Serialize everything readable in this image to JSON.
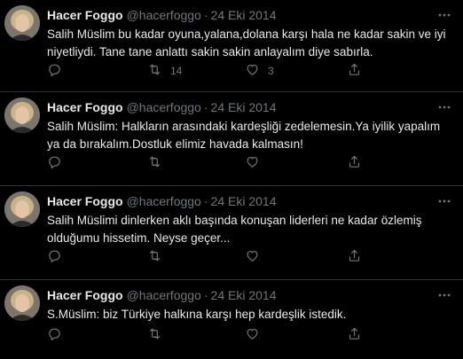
{
  "colors": {
    "background": "#000000",
    "text": "#e7e9ea",
    "muted": "#71767b",
    "divider": "#2f3336"
  },
  "icons": {
    "reply": "reply-icon",
    "retweet": "retweet-icon",
    "like": "heart-icon",
    "share": "share-icon",
    "more": "more-icon"
  },
  "tweets": [
    {
      "author_name": "Hacer Foggo",
      "handle": "@hacerfoggo",
      "separator": "·",
      "date": "24 Eki 2014",
      "text": "Salih Müslim bu kadar oyuna,yalana,dolana karşı hala ne kadar sakin ve iyi niyetliydi. Tane tane anlattı sakin sakin anlayalım diye sabırla.",
      "reply_count": "",
      "retweet_count": "14",
      "like_count": "3"
    },
    {
      "author_name": "Hacer Foggo",
      "handle": "@hacerfoggo",
      "separator": "·",
      "date": "24 Eki 2014",
      "text": "Salih Müslim: Halkların arasındaki kardeşliği zedelemesin.Ya iyilik yapalım ya da bırakalım.Dostluk elimiz havada kalmasın!",
      "reply_count": "",
      "retweet_count": "",
      "like_count": ""
    },
    {
      "author_name": "Hacer Foggo",
      "handle": "@hacerfoggo",
      "separator": "·",
      "date": "24 Eki 2014",
      "text": "Salih Müslimi dinlerken aklı başında konuşan liderleri ne kadar özlemiş olduğumu hissetim. Neyse geçer...",
      "reply_count": "",
      "retweet_count": "",
      "like_count": ""
    },
    {
      "author_name": "Hacer Foggo",
      "handle": "@hacerfoggo",
      "separator": "·",
      "date": "24 Eki 2014",
      "text": "S.Müslim: biz Türkiye halkına karşı hep kardeşlik istedik.",
      "reply_count": "",
      "retweet_count": "",
      "like_count": ""
    }
  ]
}
